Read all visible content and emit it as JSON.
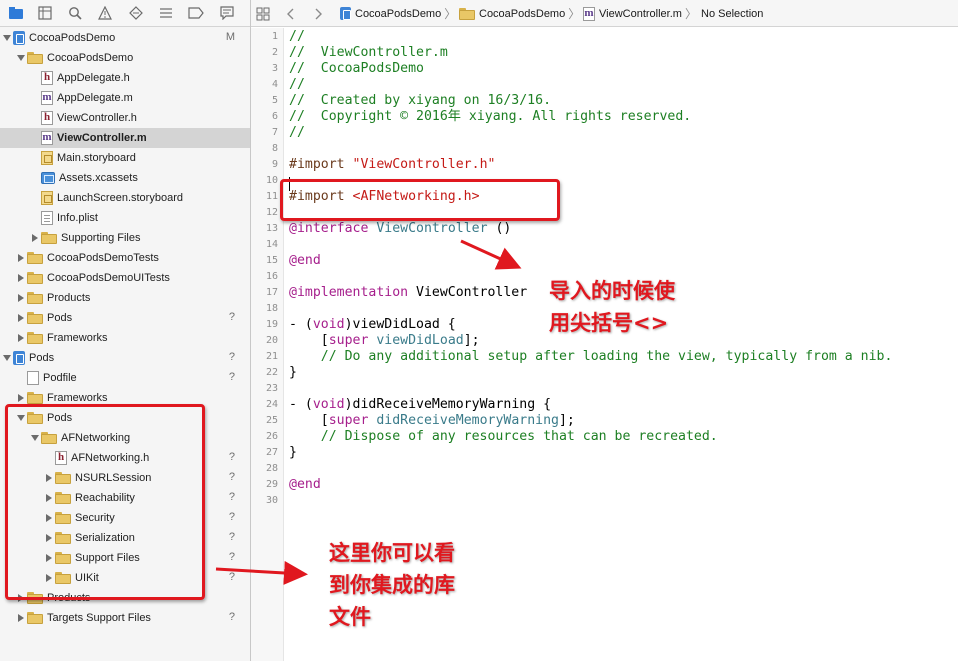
{
  "navigator": {
    "items": [
      {
        "label": "CocoaPodsDemo",
        "icon": "project-icon",
        "indent": 0,
        "disclosure": "open",
        "status": "M"
      },
      {
        "label": "CocoaPodsDemo",
        "icon": "folder-icon",
        "indent": 1,
        "disclosure": "open",
        "status": ""
      },
      {
        "label": "AppDelegate.h",
        "icon": "header-file-icon",
        "indent": 2,
        "disclosure": "none",
        "status": ""
      },
      {
        "label": "AppDelegate.m",
        "icon": "implementation-file-icon",
        "indent": 2,
        "disclosure": "none",
        "status": ""
      },
      {
        "label": "ViewController.h",
        "icon": "header-file-icon",
        "indent": 2,
        "disclosure": "none",
        "status": ""
      },
      {
        "label": "ViewController.m",
        "icon": "implementation-file-icon",
        "indent": 2,
        "disclosure": "none",
        "status": "",
        "selected": true
      },
      {
        "label": "Main.storyboard",
        "icon": "storyboard-icon",
        "indent": 2,
        "disclosure": "none",
        "status": ""
      },
      {
        "label": "Assets.xcassets",
        "icon": "asset-catalog-icon",
        "indent": 2,
        "disclosure": "none",
        "status": ""
      },
      {
        "label": "LaunchScreen.storyboard",
        "icon": "storyboard-icon",
        "indent": 2,
        "disclosure": "none",
        "status": ""
      },
      {
        "label": "Info.plist",
        "icon": "plist-file-icon",
        "indent": 2,
        "disclosure": "none",
        "status": ""
      },
      {
        "label": "Supporting Files",
        "icon": "folder-icon",
        "indent": 2,
        "disclosure": "closed",
        "status": ""
      },
      {
        "label": "CocoaPodsDemoTests",
        "icon": "folder-icon",
        "indent": 1,
        "disclosure": "closed",
        "status": ""
      },
      {
        "label": "CocoaPodsDemoUITests",
        "icon": "folder-icon",
        "indent": 1,
        "disclosure": "closed",
        "status": ""
      },
      {
        "label": "Products",
        "icon": "folder-icon",
        "indent": 1,
        "disclosure": "closed",
        "status": ""
      },
      {
        "label": "Pods",
        "icon": "folder-icon",
        "indent": 1,
        "disclosure": "closed",
        "status": "?"
      },
      {
        "label": "Frameworks",
        "icon": "folder-icon",
        "indent": 1,
        "disclosure": "closed",
        "status": ""
      },
      {
        "label": "Pods",
        "icon": "project-icon",
        "indent": 0,
        "disclosure": "open",
        "status": "?"
      },
      {
        "label": "Podfile",
        "icon": "podfile-icon",
        "indent": 1,
        "disclosure": "none",
        "status": "?"
      },
      {
        "label": "Frameworks",
        "icon": "folder-icon",
        "indent": 1,
        "disclosure": "closed",
        "status": ""
      },
      {
        "label": "Pods",
        "icon": "folder-icon",
        "indent": 1,
        "disclosure": "open",
        "status": ""
      },
      {
        "label": "AFNetworking",
        "icon": "folder-icon",
        "indent": 2,
        "disclosure": "open",
        "status": ""
      },
      {
        "label": "AFNetworking.h",
        "icon": "header-file-icon",
        "indent": 3,
        "disclosure": "none",
        "status": "?"
      },
      {
        "label": "NSURLSession",
        "icon": "folder-icon",
        "indent": 3,
        "disclosure": "closed",
        "status": "?"
      },
      {
        "label": "Reachability",
        "icon": "folder-icon",
        "indent": 3,
        "disclosure": "closed",
        "status": "?"
      },
      {
        "label": "Security",
        "icon": "folder-icon",
        "indent": 3,
        "disclosure": "closed",
        "status": "?"
      },
      {
        "label": "Serialization",
        "icon": "folder-icon",
        "indent": 3,
        "disclosure": "closed",
        "status": "?"
      },
      {
        "label": "Support Files",
        "icon": "folder-icon",
        "indent": 3,
        "disclosure": "closed",
        "status": "?"
      },
      {
        "label": "UIKit",
        "icon": "folder-icon",
        "indent": 3,
        "disclosure": "closed",
        "status": "?"
      },
      {
        "label": "Products",
        "icon": "folder-icon",
        "indent": 1,
        "disclosure": "closed",
        "status": ""
      },
      {
        "label": "Targets Support Files",
        "icon": "folder-icon",
        "indent": 1,
        "disclosure": "closed",
        "status": "?"
      }
    ]
  },
  "jumpbar": {
    "project": "CocoaPodsDemo",
    "group": "CocoaPodsDemo",
    "file": "ViewController.m",
    "selection": "No Selection"
  },
  "editor": {
    "lines": [
      {
        "n": "1",
        "parts": [
          {
            "t": "//",
            "c": "cm"
          }
        ]
      },
      {
        "n": "2",
        "parts": [
          {
            "t": "//  ViewController.m",
            "c": "cm"
          }
        ]
      },
      {
        "n": "3",
        "parts": [
          {
            "t": "//  CocoaPodsDemo",
            "c": "cm"
          }
        ]
      },
      {
        "n": "4",
        "parts": [
          {
            "t": "//",
            "c": "cm"
          }
        ]
      },
      {
        "n": "5",
        "parts": [
          {
            "t": "//  Created by xiyang on 16/3/16.",
            "c": "cm"
          }
        ]
      },
      {
        "n": "6",
        "parts": [
          {
            "t": "//  Copyright © 2016年 xiyang. All rights reserved.",
            "c": "cm"
          }
        ]
      },
      {
        "n": "7",
        "parts": [
          {
            "t": "//",
            "c": "cm"
          }
        ]
      },
      {
        "n": "8",
        "parts": []
      },
      {
        "n": "9",
        "parts": [
          {
            "t": "#import ",
            "c": "pp"
          },
          {
            "t": "\"ViewController.h\"",
            "c": "st"
          }
        ]
      },
      {
        "n": "10",
        "parts": []
      },
      {
        "n": "11",
        "parts": [
          {
            "t": "#import ",
            "c": "pp"
          },
          {
            "t": "<AFNetworking.h>",
            "c": "st"
          }
        ]
      },
      {
        "n": "12",
        "parts": []
      },
      {
        "n": "13",
        "parts": [
          {
            "t": "@interface",
            "c": "kw"
          },
          {
            "t": " ",
            "c": ""
          },
          {
            "t": "ViewController",
            "c": "cls"
          },
          {
            "t": " ()",
            "c": ""
          }
        ]
      },
      {
        "n": "14",
        "parts": []
      },
      {
        "n": "15",
        "parts": [
          {
            "t": "@end",
            "c": "kw"
          }
        ]
      },
      {
        "n": "16",
        "parts": []
      },
      {
        "n": "17",
        "parts": [
          {
            "t": "@implementation",
            "c": "kw"
          },
          {
            "t": " ViewController",
            "c": ""
          }
        ]
      },
      {
        "n": "18",
        "parts": []
      },
      {
        "n": "19",
        "parts": [
          {
            "t": "- (",
            "c": ""
          },
          {
            "t": "void",
            "c": "kw"
          },
          {
            "t": ")viewDidLoad {",
            "c": ""
          }
        ]
      },
      {
        "n": "20",
        "parts": [
          {
            "t": "    [",
            "c": ""
          },
          {
            "t": "super",
            "c": "kw"
          },
          {
            "t": " ",
            "c": ""
          },
          {
            "t": "viewDidLoad",
            "c": "mth"
          },
          {
            "t": "];",
            "c": ""
          }
        ]
      },
      {
        "n": "21",
        "parts": [
          {
            "t": "    // Do any additional setup after loading the view, typically from a nib.",
            "c": "cm"
          }
        ]
      },
      {
        "n": "22",
        "parts": [
          {
            "t": "}",
            "c": ""
          }
        ]
      },
      {
        "n": "23",
        "parts": []
      },
      {
        "n": "24",
        "parts": [
          {
            "t": "- (",
            "c": ""
          },
          {
            "t": "void",
            "c": "kw"
          },
          {
            "t": ")didReceiveMemoryWarning {",
            "c": ""
          }
        ]
      },
      {
        "n": "25",
        "parts": [
          {
            "t": "    [",
            "c": ""
          },
          {
            "t": "super",
            "c": "kw"
          },
          {
            "t": " ",
            "c": ""
          },
          {
            "t": "didReceiveMemoryWarning",
            "c": "mth"
          },
          {
            "t": "];",
            "c": ""
          }
        ]
      },
      {
        "n": "26",
        "parts": [
          {
            "t": "    // Dispose of any resources that can be recreated.",
            "c": "cm"
          }
        ]
      },
      {
        "n": "27",
        "parts": [
          {
            "t": "}",
            "c": ""
          }
        ]
      },
      {
        "n": "28",
        "parts": []
      },
      {
        "n": "29",
        "parts": [
          {
            "t": "@end",
            "c": "kw"
          }
        ]
      },
      {
        "n": "30",
        "parts": []
      }
    ]
  },
  "annotations": {
    "import_note": [
      "导入的时候使",
      "用尖括号<>"
    ],
    "pods_note": [
      "这里你可以看",
      "到你集成的库",
      "文件"
    ]
  },
  "colors": {
    "annotation_red": "#e0181f",
    "comment_green": "#1d7f23",
    "keyword_purple": "#a61f8c",
    "string_red": "#c41a16",
    "selection_gray": "#d4d4d4"
  }
}
